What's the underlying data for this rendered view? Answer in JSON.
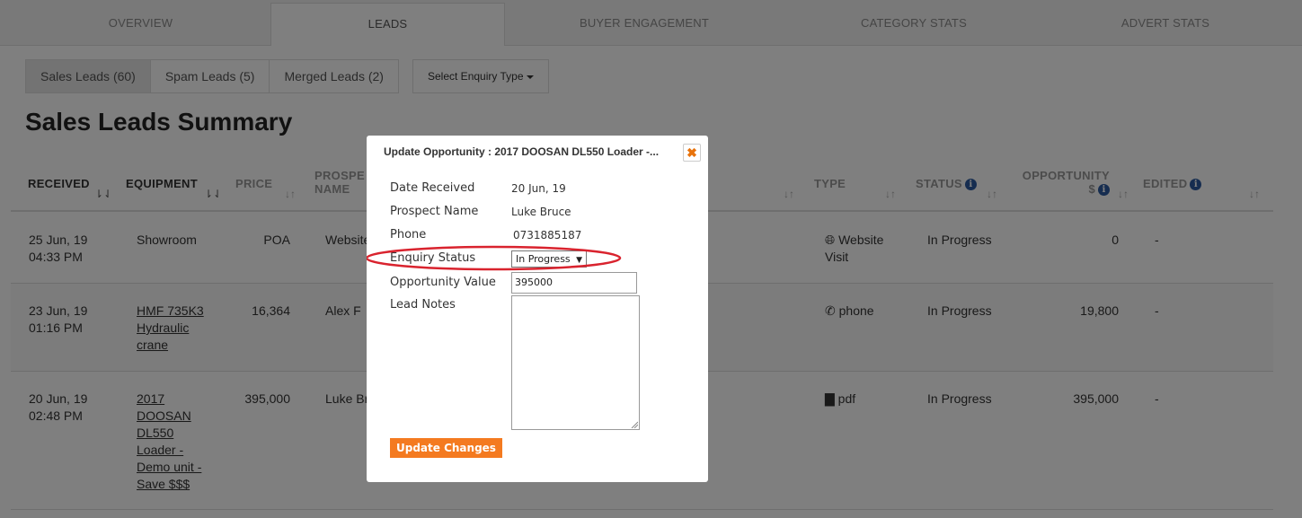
{
  "top_tabs": [
    "OVERVIEW",
    "LEADS",
    "BUYER ENGAGEMENT",
    "CATEGORY STATS",
    "ADVERT STATS"
  ],
  "sub_tabs": [
    "Sales Leads (60)",
    "Spam Leads (5)",
    "Merged Leads (2)"
  ],
  "enquiry_type_label": "Select Enquiry Type",
  "page_title": "Sales Leads Summary",
  "table": {
    "headers": {
      "received": "RECEIVED",
      "equipment": "EQUIPMENT",
      "price": "PRICE",
      "prospect_line1": "PROSPE",
      "prospect_line2": "NAME",
      "type": "TYPE",
      "status": "STATUS",
      "opportunity_line1": "OPPORTUNITY",
      "opportunity_line2": "$",
      "edited": "EDITED"
    },
    "rows": [
      {
        "received_date": "25 Jun, 19",
        "received_time": "04:33 PM",
        "equipment": [
          "Showroom"
        ],
        "equipment_link": false,
        "price": "POA",
        "prospect": "Website",
        "type_icon": "globe-icon",
        "type_lines": [
          "Website",
          "Visit"
        ],
        "status": "In Progress",
        "opportunity": "0",
        "edited": "-"
      },
      {
        "received_date": "23 Jun, 19",
        "received_time": "01:16 PM",
        "equipment": [
          "HMF 735K3",
          "Hydraulic",
          "crane"
        ],
        "equipment_link": true,
        "price": "16,364",
        "prospect": "Alex F",
        "type_icon": "phone-icon",
        "type_lines": [
          "phone"
        ],
        "status": "In Progress",
        "opportunity": "19,800",
        "edited": "-"
      },
      {
        "received_date": "20 Jun, 19",
        "received_time": "02:48 PM",
        "equipment": [
          "2017",
          "DOOSAN",
          "DL550",
          "Loader -",
          "Demo unit -",
          "Save $$$"
        ],
        "equipment_link": true,
        "price": "395,000",
        "prospect": "Luke Br",
        "type_icon": "file-icon",
        "type_lines": [
          "pdf"
        ],
        "status": "In Progress",
        "opportunity": "395,000",
        "edited": "-"
      }
    ]
  },
  "modal": {
    "title": "Update Opportunity : 2017 DOOSAN DL550 Loader -...",
    "close_symbol": "✖",
    "fields": {
      "date_received_label": "Date Received",
      "date_received_value": "20 Jun, 19",
      "prospect_name_label": "Prospect Name",
      "prospect_name_value": "Luke Bruce",
      "phone_label": "Phone",
      "phone_value": "0731885187",
      "enquiry_status_label": "Enquiry Status",
      "enquiry_status_value": "In Progress",
      "opportunity_value_label": "Opportunity Value",
      "opportunity_value_value": "395000",
      "lead_notes_label": "Lead Notes"
    },
    "update_button": "Update Changes"
  },
  "colors": {
    "accent_orange": "#f47a20",
    "info_blue": "#2c5aa0",
    "highlight_red": "#d9232e"
  }
}
